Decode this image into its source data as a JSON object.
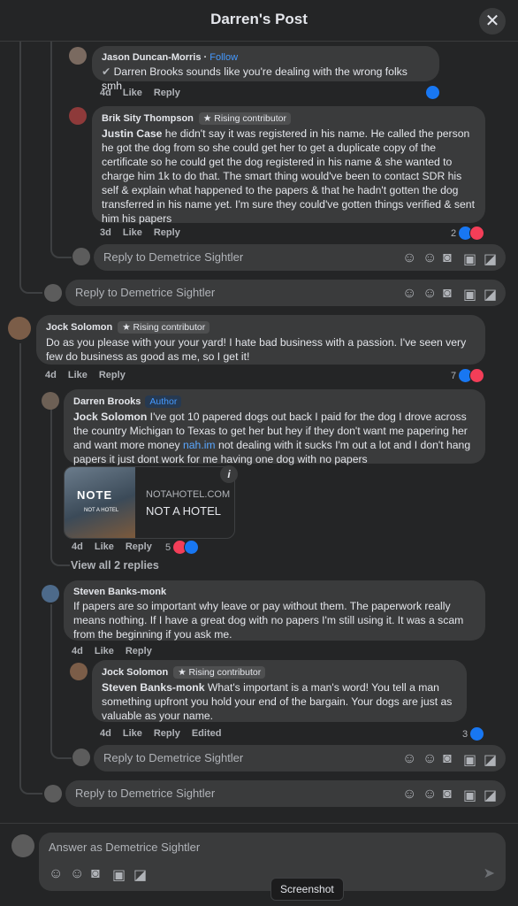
{
  "header": {
    "title": "Darren's Post",
    "close_icon": "close-icon"
  },
  "comments": {
    "jason": {
      "name": "Jason Duncan-Morris",
      "follow": "Follow",
      "mention": "Darren Brooks",
      "text": " sounds like you're dealing with the wrong folks smh",
      "time": "4d",
      "like": "Like",
      "reply": "Reply"
    },
    "brik": {
      "name": "Brik Sity Thompson",
      "badge": "Rising contributor",
      "mention": "Justin Case",
      "text": " he didn't say it was registered in his name. He called the person he got the dog from so she could get her to get a duplicate copy of the certificate so he could get the dog registered in his name & she wanted to charge him 1k to do that. The smart thing would've been to contact SDR his self & explain what happened to the papers & that he hadn't gotten the dog transferred in his name yet. I'm sure they could've gotten things verified & sent him his papers",
      "time": "3d",
      "like": "Like",
      "reply": "Reply",
      "reaction_count": "2"
    },
    "jock1": {
      "name": "Jock Solomon",
      "badge": "Rising contributor",
      "text": "Do as you please with your your yard! I hate bad business with a passion. I've seen very few do business as good as me, so I get it!",
      "time": "4d",
      "like": "Like",
      "reply": "Reply",
      "reaction_count": "7"
    },
    "darren": {
      "name": "Darren Brooks",
      "author": "Author",
      "mention": "Jock Solomon",
      "text1": " I've got 10 papered dogs out back I paid for the dog I drove across the country Michigan to Texas to get her but hey if they don't want me papering her and want more money ",
      "link": "nah.im",
      "text2": " not dealing with it sucks I'm out a lot and I don't hang papers it just dont work for me having one dog with no papers",
      "time": "4d",
      "like": "Like",
      "reply": "Reply",
      "reaction_count": "5"
    },
    "steven": {
      "name": "Steven Banks-monk",
      "text": "If papers are so important why leave or pay without them. The paperwork really means nothing. If I have a great dog with no papers I'm still using it. It was a scam from the beginning if you ask me.",
      "time": "4d",
      "like": "Like",
      "reply": "Reply"
    },
    "jock2": {
      "name": "Jock Solomon",
      "badge": "Rising contributor",
      "mention": "Steven Banks-monk",
      "text": " What's important is a man's word! You tell a man something upfront you hold your end of the bargain. Your dogs are just as valuable as your name.",
      "time": "4d",
      "like": "Like",
      "reply": "Reply",
      "edited": "Edited",
      "reaction_count": "3"
    }
  },
  "link_preview": {
    "domain": "NOTAHOTEL.COM",
    "title": "NOT A HOTEL",
    "image_text": "NOT A HOTEL",
    "logo_text": "NOTE",
    "info": "i"
  },
  "view_replies": "View all 2 replies",
  "reply_placeholder": "Reply to Demetrice Sightler",
  "composer": {
    "placeholder": "Answer as Demetrice Sightler"
  },
  "tooltip": "Screenshot",
  "colors": {
    "accent": "#1877f2",
    "heart": "#f33e58",
    "link": "#5aa7ff",
    "bg": "#242526",
    "bubble": "#3a3b3c"
  }
}
